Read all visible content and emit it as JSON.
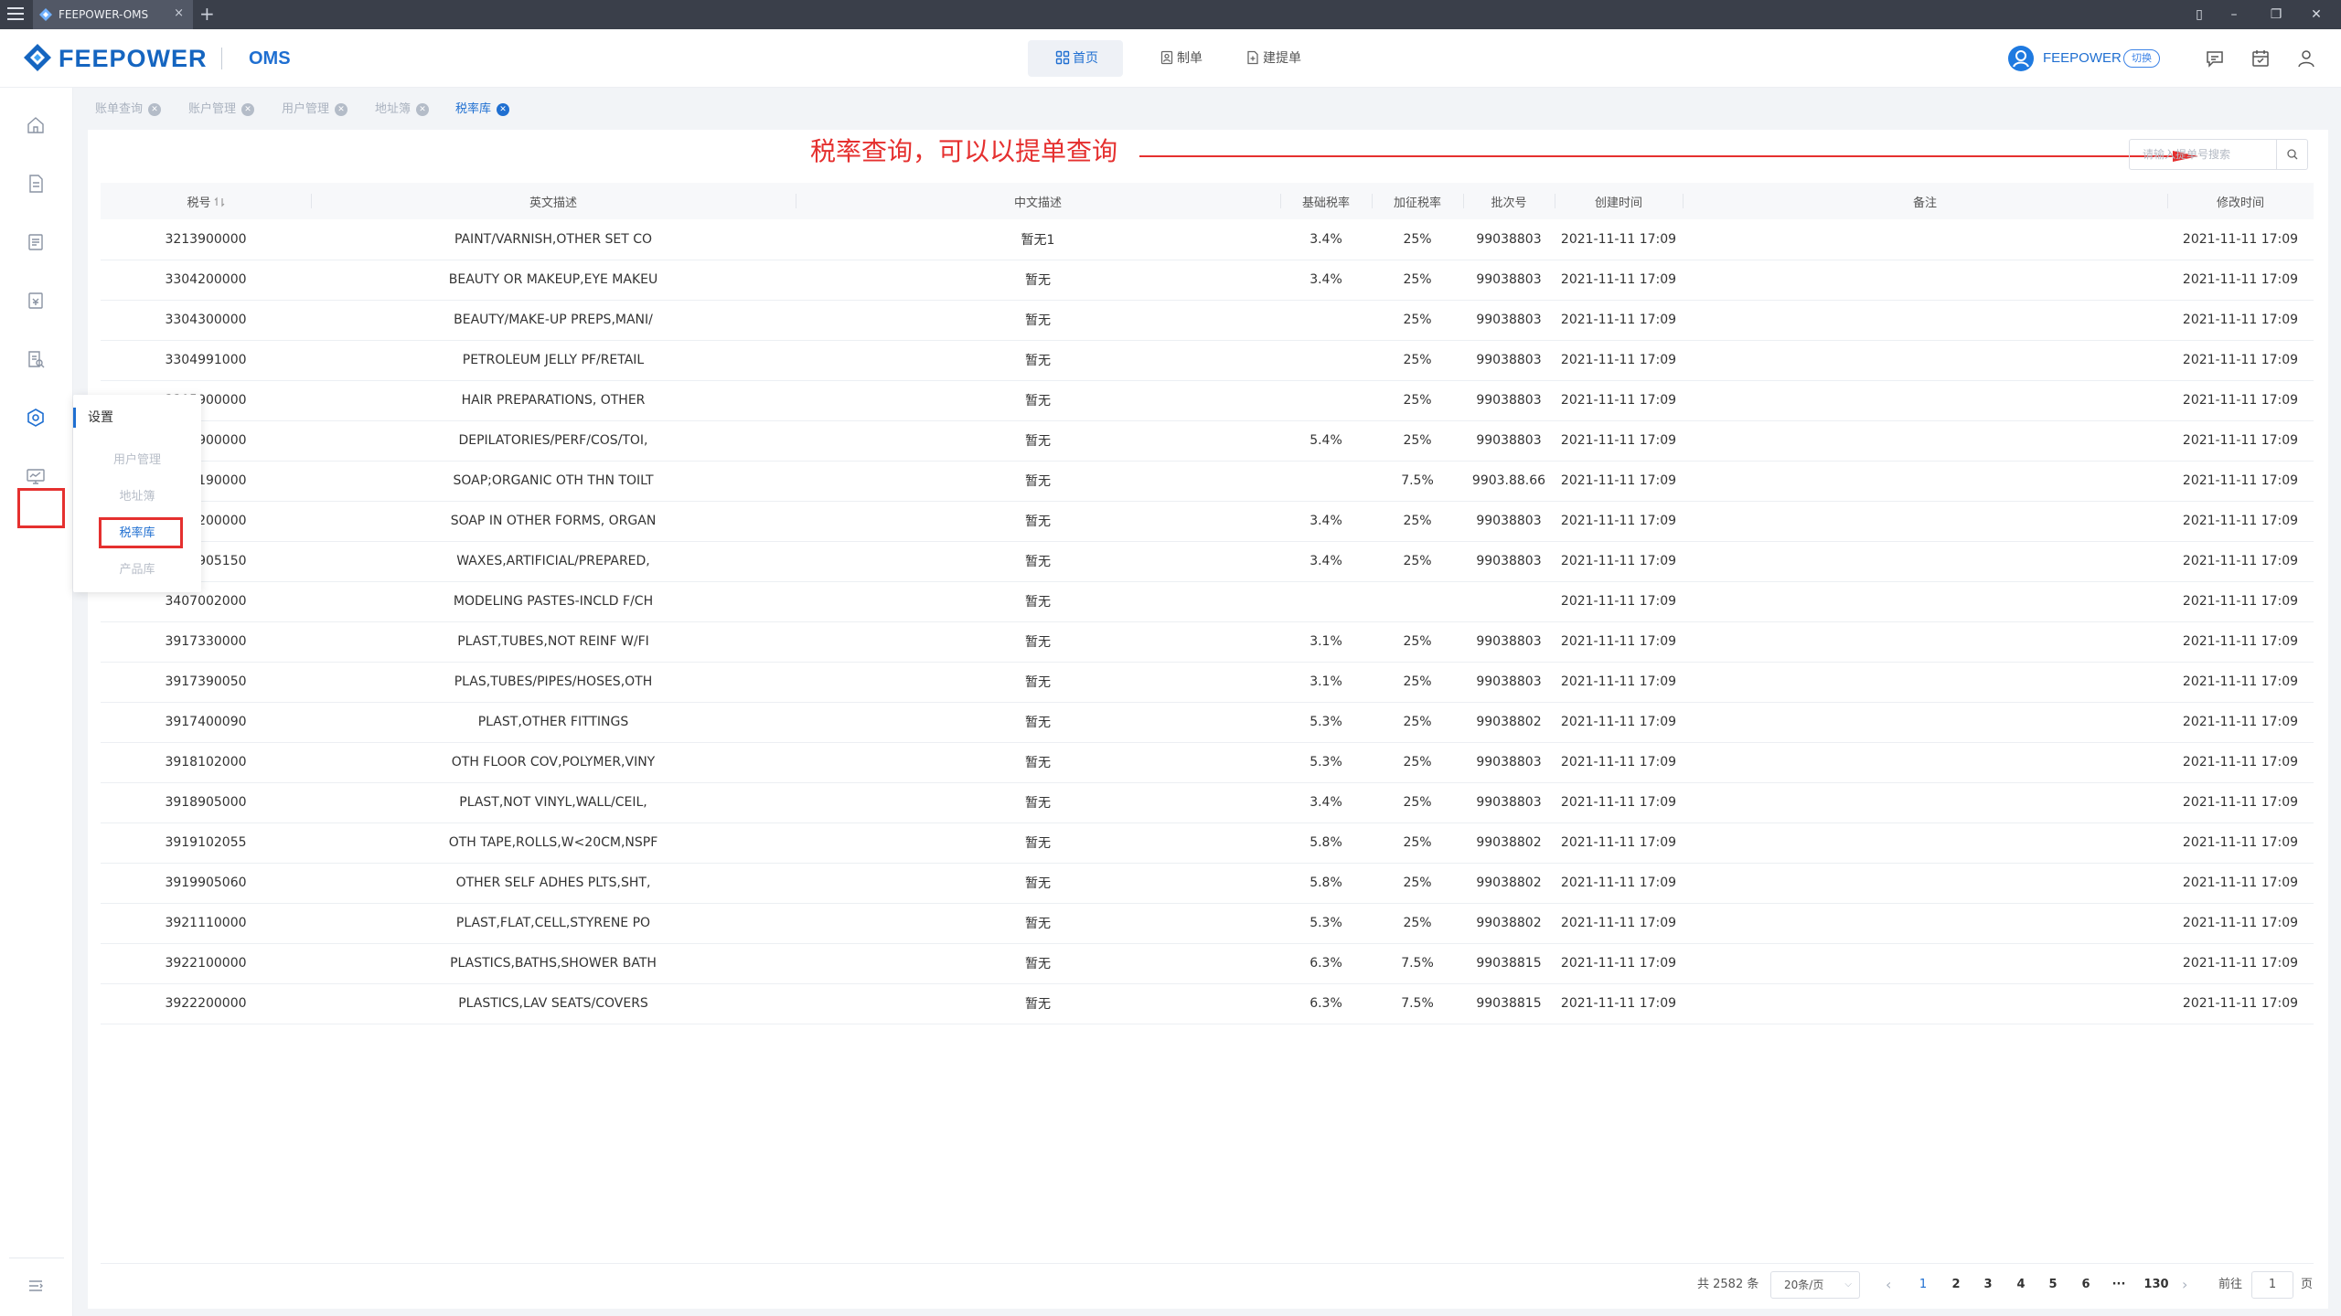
{
  "window": {
    "tab_title": "FEEPOWER-OMS",
    "tab_close": "×",
    "new_tab": "+"
  },
  "header": {
    "logo_text": "FEEPOWER",
    "logo_sub": "OMS",
    "nav": [
      {
        "label": "首页",
        "icon": "grid-icon",
        "active": true
      },
      {
        "label": "制单",
        "icon": "document-person-icon",
        "active": false
      },
      {
        "label": "建提单",
        "icon": "document-add-icon",
        "active": false
      }
    ],
    "user_name": "FEEPOWER",
    "switch_label": "切换"
  },
  "flyout": {
    "title": "设置",
    "items": [
      "用户管理",
      "地址簿",
      "税率库",
      "产品库"
    ],
    "active_index": 2
  },
  "tabs": [
    {
      "label": "账单查询",
      "active": false
    },
    {
      "label": "账户管理",
      "active": false
    },
    {
      "label": "用户管理",
      "active": false
    },
    {
      "label": "地址簿",
      "active": false
    },
    {
      "label": "税率库",
      "active": true
    }
  ],
  "annotation": "税率查询，可以以提单查询",
  "search": {
    "placeholder": "请输入提单号搜索",
    "value": ""
  },
  "table": {
    "columns": [
      "税号",
      "英文描述",
      "中文描述",
      "基础税率",
      "加征税率",
      "批次号",
      "创建时间",
      "备注",
      "修改时间"
    ],
    "rows": [
      [
        "3213900000",
        "PAINT/VARNISH,OTHER SET CO",
        "暂无1",
        "3.4%",
        "25%",
        "99038803",
        "2021-11-11 17:09",
        "",
        "2021-11-11 17:09"
      ],
      [
        "3304200000",
        "BEAUTY OR MAKEUP,EYE MAKEU",
        "暂无",
        "3.4%",
        "25%",
        "99038803",
        "2021-11-11 17:09",
        "",
        "2021-11-11 17:09"
      ],
      [
        "3304300000",
        "BEAUTY/MAKE-UP PREPS,MANI/",
        "暂无",
        "",
        "25%",
        "99038803",
        "2021-11-11 17:09",
        "",
        "2021-11-11 17:09"
      ],
      [
        "3304991000",
        "PETROLEUM JELLY PF/RETAIL",
        "暂无",
        "",
        "25%",
        "99038803",
        "2021-11-11 17:09",
        "",
        "2021-11-11 17:09"
      ],
      [
        "3305900000",
        "HAIR PREPARATIONS, OTHER",
        "暂无",
        "",
        "25%",
        "99038803",
        "2021-11-11 17:09",
        "",
        "2021-11-11 17:09"
      ],
      [
        "3307900000",
        "DEPILATORIES/PERF/COS/TOI,",
        "暂无",
        "5.4%",
        "25%",
        "99038803",
        "2021-11-11 17:09",
        "",
        "2021-11-11 17:09"
      ],
      [
        "3401190000",
        "SOAP;ORGANIC OTH THN TOILT",
        "暂无",
        "",
        "7.5%",
        "9903.88.66",
        "2021-11-11 17:09",
        "",
        "2021-11-11 17:09"
      ],
      [
        "3401200000",
        "SOAP IN OTHER FORMS, ORGAN",
        "暂无",
        "3.4%",
        "25%",
        "99038803",
        "2021-11-11 17:09",
        "",
        "2021-11-11 17:09"
      ],
      [
        "3404905150",
        "WAXES,ARTIFICIAL/PREPARED,",
        "暂无",
        "3.4%",
        "25%",
        "99038803",
        "2021-11-11 17:09",
        "",
        "2021-11-11 17:09"
      ],
      [
        "3407002000",
        "MODELING PASTES-INCLD F/CH",
        "暂无",
        "",
        "",
        "",
        "2021-11-11 17:09",
        "",
        "2021-11-11 17:09"
      ],
      [
        "3917330000",
        "PLAST,TUBES,NOT REINF W/FI",
        "暂无",
        "3.1%",
        "25%",
        "99038803",
        "2021-11-11 17:09",
        "",
        "2021-11-11 17:09"
      ],
      [
        "3917390050",
        "PLAS,TUBES/PIPES/HOSES,OTH",
        "暂无",
        "3.1%",
        "25%",
        "99038803",
        "2021-11-11 17:09",
        "",
        "2021-11-11 17:09"
      ],
      [
        "3917400090",
        "PLAST,OTHER FITTINGS",
        "暂无",
        "5.3%",
        "25%",
        "99038802",
        "2021-11-11 17:09",
        "",
        "2021-11-11 17:09"
      ],
      [
        "3918102000",
        "OTH FLOOR COV,POLYMER,VINY",
        "暂无",
        "5.3%",
        "25%",
        "99038803",
        "2021-11-11 17:09",
        "",
        "2021-11-11 17:09"
      ],
      [
        "3918905000",
        "PLAST,NOT VINYL,WALL/CEIL,",
        "暂无",
        "3.4%",
        "25%",
        "99038803",
        "2021-11-11 17:09",
        "",
        "2021-11-11 17:09"
      ],
      [
        "3919102055",
        "OTH TAPE,ROLLS,W<20CM,NSPF",
        "暂无",
        "5.8%",
        "25%",
        "99038802",
        "2021-11-11 17:09",
        "",
        "2021-11-11 17:09"
      ],
      [
        "3919905060",
        "OTHER SELF ADHES PLTS,SHT,",
        "暂无",
        "5.8%",
        "25%",
        "99038802",
        "2021-11-11 17:09",
        "",
        "2021-11-11 17:09"
      ],
      [
        "3921110000",
        "PLAST,FLAT,CELL,STYRENE PO",
        "暂无",
        "5.3%",
        "25%",
        "99038802",
        "2021-11-11 17:09",
        "",
        "2021-11-11 17:09"
      ],
      [
        "3922100000",
        "PLASTICS,BATHS,SHOWER BATH",
        "暂无",
        "6.3%",
        "7.5%",
        "99038815",
        "2021-11-11 17:09",
        "",
        "2021-11-11 17:09"
      ],
      [
        "3922200000",
        "PLASTICS,LAV SEATS/COVERS",
        "暂无",
        "6.3%",
        "7.5%",
        "99038815",
        "2021-11-11 17:09",
        "",
        "2021-11-11 17:09"
      ]
    ]
  },
  "pagination": {
    "total_text": "共 2582 条",
    "page_size": "20条/页",
    "pages": [
      "1",
      "2",
      "3",
      "4",
      "5",
      "6"
    ],
    "ellipsis": "···",
    "last_page": "130",
    "current": "1",
    "goto_label": "前往",
    "goto_value": "1",
    "unit": "页"
  },
  "colors": {
    "brand": "#1f6fd1",
    "annotation_red": "#e5302f"
  }
}
